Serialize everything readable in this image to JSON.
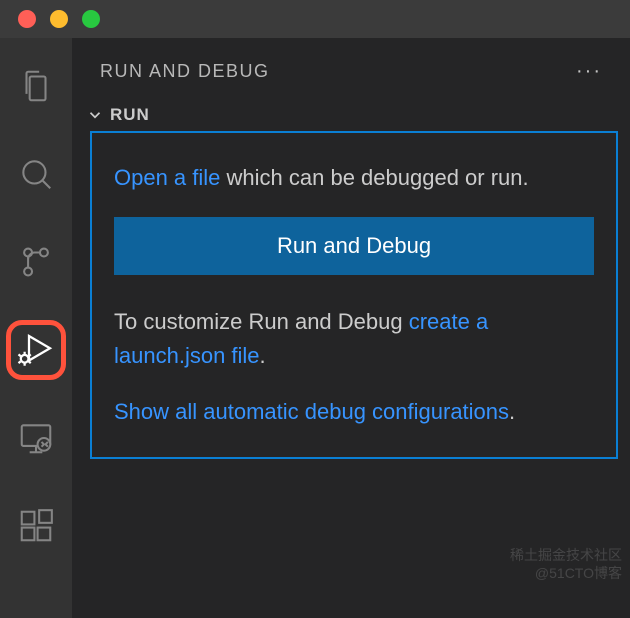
{
  "titlebar": {
    "traffic": [
      "close",
      "minimize",
      "zoom"
    ]
  },
  "activitybar": {
    "items": [
      {
        "name": "explorer-icon"
      },
      {
        "name": "search-icon"
      },
      {
        "name": "source-control-icon"
      },
      {
        "name": "run-debug-icon",
        "active": true
      },
      {
        "name": "remote-explorer-icon"
      },
      {
        "name": "extensions-icon"
      }
    ]
  },
  "sidebar": {
    "title": "RUN AND DEBUG",
    "more_label": "···",
    "section_label": "RUN"
  },
  "panel": {
    "open_file_link": "Open a file",
    "open_file_suffix": " which can be debugged or run.",
    "run_button": "Run and Debug",
    "customize_prefix": "To customize Run and Debug ",
    "create_launch_link": "create a launch.json file",
    "customize_suffix": ".",
    "show_all_link": "Show all automatic debug configurations",
    "show_all_suffix": "."
  },
  "watermark": {
    "line1": "稀土掘金技术社区",
    "line2": "@51CTO博客"
  }
}
